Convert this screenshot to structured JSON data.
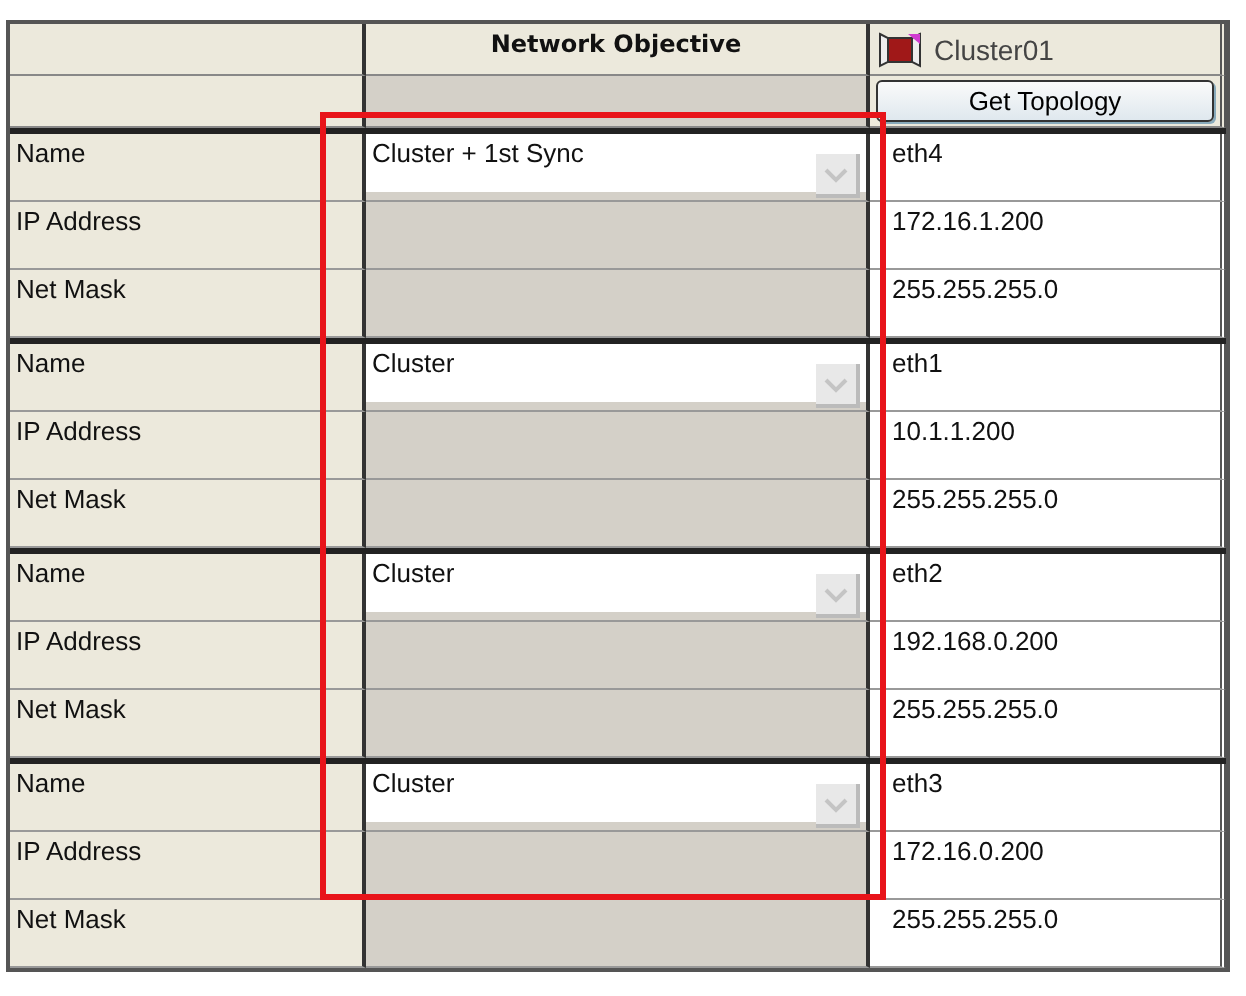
{
  "header": {
    "column_2": "Network Objective",
    "cluster": "Cluster01",
    "button": "Get Topology"
  },
  "groups": [
    {
      "name_label": "Name",
      "ip_label": "IP Address",
      "mask_label": "Net Mask",
      "objective": "Cluster + 1st Sync",
      "nic": "eth4",
      "ip": "172.16.1.200",
      "mask": "255.255.255.0"
    },
    {
      "name_label": "Name",
      "ip_label": "IP Address",
      "mask_label": "Net Mask",
      "objective": "Cluster",
      "nic": "eth1",
      "ip": "10.1.1.200",
      "mask": "255.255.255.0"
    },
    {
      "name_label": "Name",
      "ip_label": "IP Address",
      "mask_label": "Net Mask",
      "objective": "Cluster",
      "nic": "eth2",
      "ip": "192.168.0.200",
      "mask": "255.255.255.0"
    },
    {
      "name_label": "Name",
      "ip_label": "IP Address",
      "mask_label": "Net Mask",
      "objective": "Cluster",
      "nic": "eth3",
      "ip": "172.16.0.200",
      "mask": "255.255.255.0"
    }
  ]
}
